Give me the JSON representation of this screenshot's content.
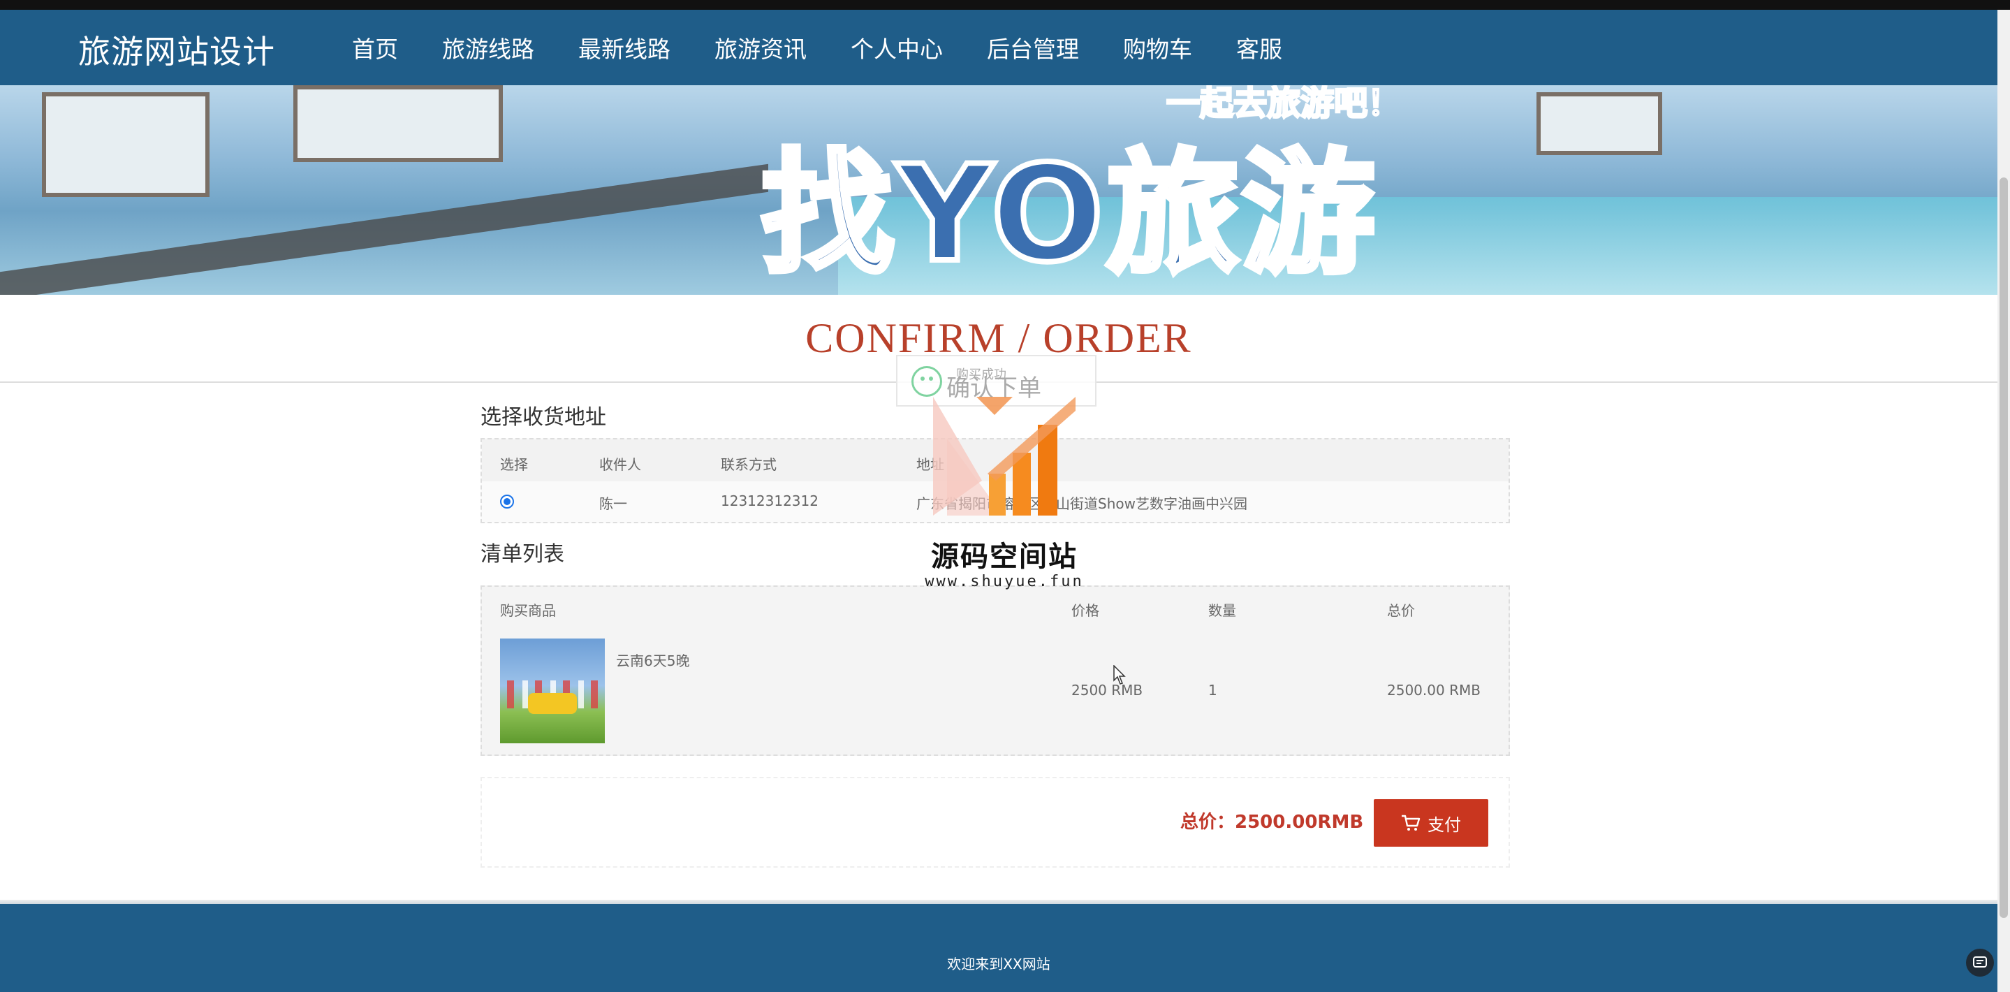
{
  "nav": {
    "brand": "旅游网站设计",
    "links": [
      "首页",
      "旅游线路",
      "最新线路",
      "旅游资讯",
      "个人中心",
      "后台管理",
      "购物车",
      "客服"
    ]
  },
  "banner": {
    "slogan": "找YO旅游",
    "slogan_top": "一起去旅游吧！"
  },
  "page_title": "CONFIRM / ORDER",
  "toast": {
    "small": "购买成功",
    "big": "确认下单"
  },
  "address": {
    "heading": "选择收货地址",
    "columns": [
      "选择",
      "收件人",
      "联系方式",
      "地址"
    ],
    "rows": [
      {
        "selected": true,
        "recipient": "陈一",
        "phone": "12312312312",
        "address": "广东省揭阳市榕城区中山街道Show艺数字油画中兴园"
      }
    ]
  },
  "list": {
    "heading": "清单列表",
    "columns": [
      "购买商品",
      "价格",
      "数量",
      "总价"
    ],
    "items": [
      {
        "name": "云南6天5晚",
        "price": "2500 RMB",
        "quantity": "1",
        "total": "2500.00 RMB"
      }
    ]
  },
  "summary": {
    "total_label": "总价：2500.00RMB",
    "pay_label": "支付"
  },
  "watermark": {
    "title": "源码空间站",
    "url": "www.shuyue.fun"
  },
  "footer": {
    "text": "欢迎来到XX网站"
  },
  "colors": {
    "nav_bg": "#1f5d89",
    "accent_red": "#c9361f",
    "title_red": "#b8402a"
  }
}
